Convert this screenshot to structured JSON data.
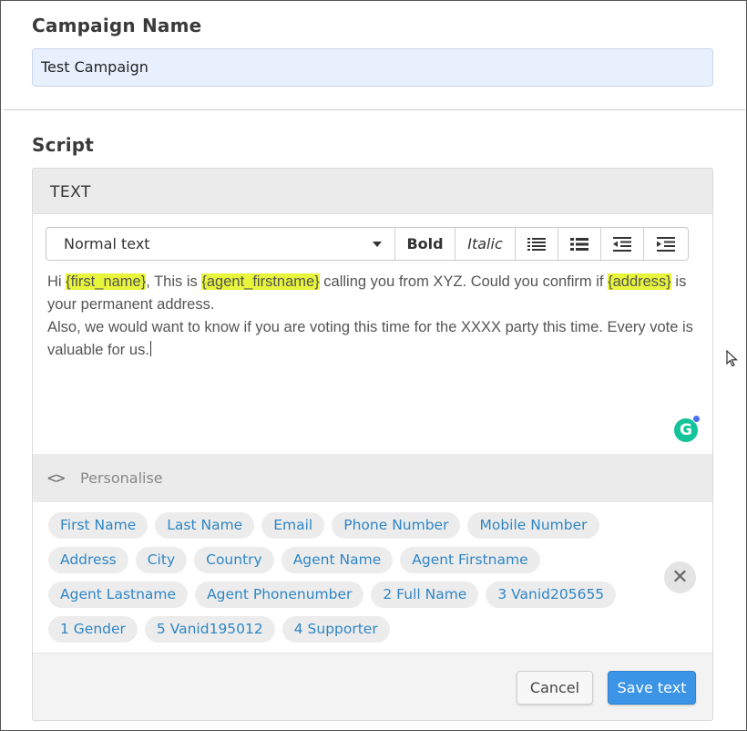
{
  "campaign": {
    "heading": "Campaign Name",
    "value": "Test Campaign"
  },
  "script": {
    "heading": "Script",
    "card_title": "TEXT",
    "toolbar": {
      "format_select": "Normal text",
      "bold_label": "Bold",
      "italic_label": "Italic",
      "icons": [
        "ordered-list-icon",
        "unordered-list-icon",
        "outdent-icon",
        "indent-icon"
      ]
    },
    "body": {
      "t1": "Hi ",
      "v1": "{first_name}",
      "t2": ", This is ",
      "v2": "{agent_firstname}",
      "t3": " calling you from XYZ. Could you confirm if ",
      "v3": "{address}",
      "t4": " is your permanent address.",
      "line2": "Also, we would want to know if you are voting this time for the XXXX party this time. Every vote is valuable for us."
    },
    "grammarly_letter": "G",
    "highlight_color": "#e8f53b"
  },
  "personalise": {
    "label": "Personalise",
    "tags": [
      "First Name",
      "Last Name",
      "Email",
      "Phone Number",
      "Mobile Number",
      "Address",
      "City",
      "Country",
      "Agent Name",
      "Agent Firstname",
      "Agent Lastname",
      "Agent Phonenumber",
      "2 Full Name",
      "3 Vanid205655",
      "1 Gender",
      "5 Vanid195012",
      "4 Supporter"
    ]
  },
  "actions": {
    "cancel_label": "Cancel",
    "save_label": "Save text",
    "save_color": "#3b94e6"
  }
}
